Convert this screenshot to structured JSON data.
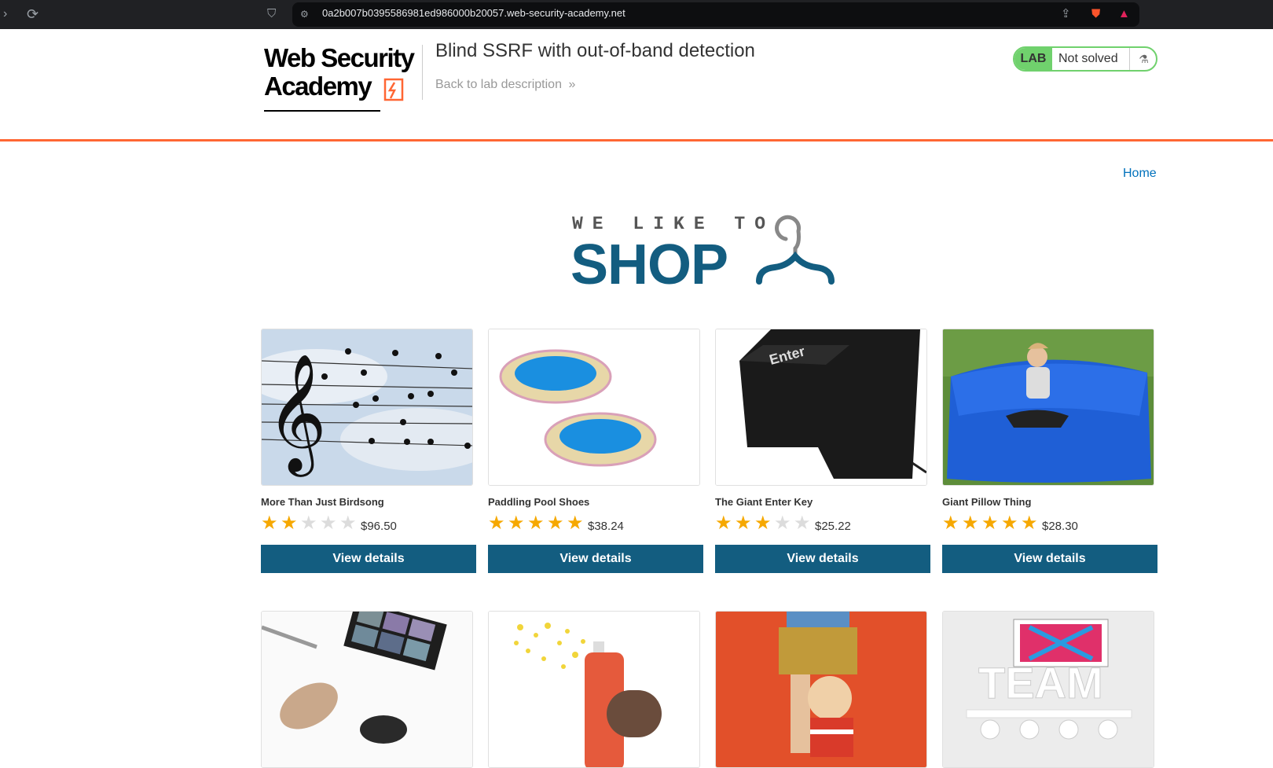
{
  "browser": {
    "url": "0a2b007b0395586981ed986000b20057.web-security-academy.net"
  },
  "header": {
    "logo_line1": "Web Security",
    "logo_line2": "Academy",
    "lab_title": "Blind SSRF with out-of-band detection",
    "back_link": "Back to lab description",
    "lab_tag": "LAB",
    "lab_status": "Not solved"
  },
  "nav": {
    "home": "Home"
  },
  "banner": {
    "line1": "WE LIKE TO",
    "line2": "SHOP"
  },
  "products": [
    {
      "name": "More Than Just Birdsong",
      "rating": 2,
      "price": "$96.50",
      "button": "View details",
      "image": "music-birds-image"
    },
    {
      "name": "Paddling Pool Shoes",
      "rating": 5,
      "price": "$38.24",
      "button": "View details",
      "image": "paddling-pools-image"
    },
    {
      "name": "The Giant Enter Key",
      "rating": 3,
      "price": "$25.22",
      "button": "View details",
      "image": "enter-key-image"
    },
    {
      "name": "Giant Pillow Thing",
      "rating": 5,
      "price": "$28.30",
      "button": "View details",
      "image": "blue-pillow-image"
    },
    {
      "name": "",
      "rating": 0,
      "price": "",
      "button": "",
      "image": "makeup-image"
    },
    {
      "name": "",
      "rating": 0,
      "price": "",
      "button": "",
      "image": "spray-can-image"
    },
    {
      "name": "",
      "rating": 0,
      "price": "",
      "button": "",
      "image": "boy-toy-image"
    },
    {
      "name": "",
      "rating": 0,
      "price": "",
      "button": "",
      "image": "team-image"
    }
  ],
  "colors": {
    "brand_blue": "#135d80",
    "accent_orange": "#ff6633",
    "lab_green": "#70d16d",
    "star": "#f6a800"
  }
}
